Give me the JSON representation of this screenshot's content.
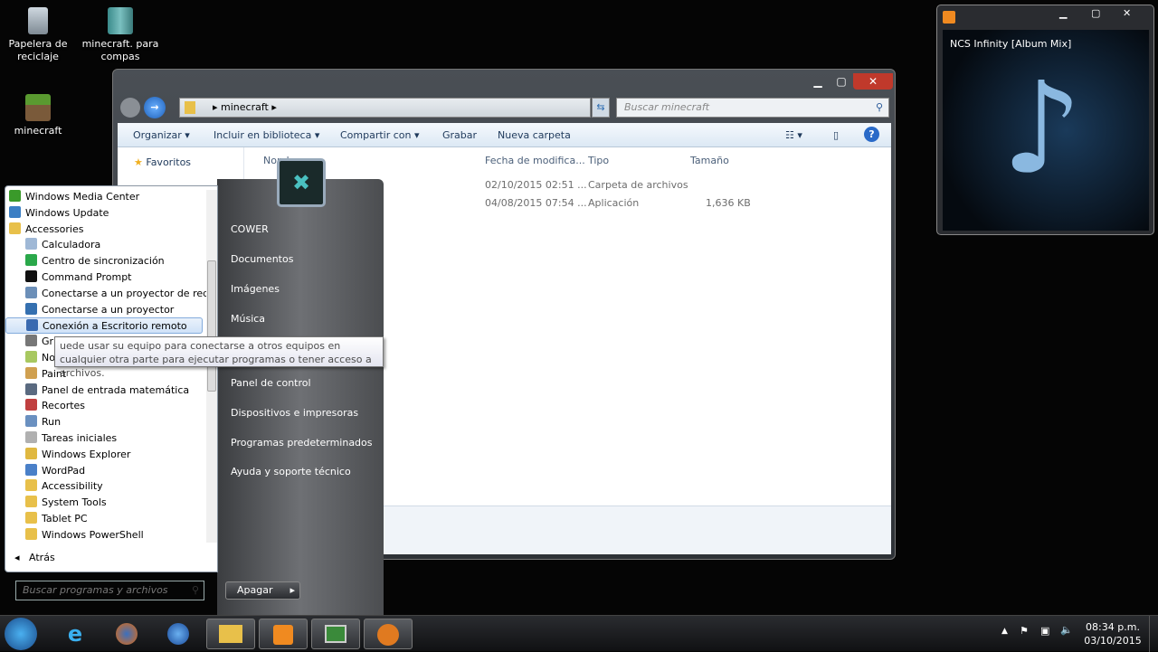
{
  "desktop": {
    "icons": [
      {
        "label": "Papelera de reciclaje",
        "icon": "recycle-bin-icon"
      },
      {
        "label": "minecraft. para compas",
        "icon": "archive-icon"
      },
      {
        "label": "minecraft",
        "icon": "minecraft-icon"
      }
    ]
  },
  "explorer": {
    "path": "minecraft",
    "search_placeholder": "Buscar minecraft",
    "toolbar": {
      "organize": "Organizar ▾",
      "include": "Incluir en biblioteca ▾",
      "share": "Compartir con ▾",
      "burn": "Grabar",
      "new_folder": "Nueva carpeta"
    },
    "nav": {
      "favorites": "Favoritos"
    },
    "columns": {
      "name": "Nombre",
      "date": "Fecha de modifica...",
      "type": "Tipo",
      "size": "Tamaño"
    },
    "rows": [
      {
        "date": "02/10/2015 02:51 ...",
        "type": "Carpeta de archivos",
        "size": ""
      },
      {
        "date": "04/08/2015 07:54 ...",
        "type": "Aplicación",
        "size": "1,636 KB"
      }
    ]
  },
  "start_menu": {
    "programs": [
      {
        "label": "Windows Media Center",
        "color": "#3a9a2a",
        "indent": false
      },
      {
        "label": "Windows Update",
        "color": "#3b7fc4",
        "indent": false
      },
      {
        "label": "Accessories",
        "color": "#e8c04a",
        "indent": false
      },
      {
        "label": "Calculadora",
        "color": "#9fb8d6",
        "indent": true
      },
      {
        "label": "Centro de sincronización",
        "color": "#2aa84a",
        "indent": true
      },
      {
        "label": "Command Prompt",
        "color": "#111111",
        "indent": true
      },
      {
        "label": "Conectarse a un proyector de red",
        "color": "#6c8fb8",
        "indent": true
      },
      {
        "label": "Conectarse a un proyector",
        "color": "#3570b0",
        "indent": true
      },
      {
        "label": "Conexión a Escritorio remoto",
        "color": "#3a6ab0",
        "indent": true,
        "selected": true
      },
      {
        "label": "Gr",
        "color": "#777777",
        "indent": true
      },
      {
        "label": "No",
        "color": "#a8c860",
        "indent": true
      },
      {
        "label": "Paint",
        "color": "#d0a050",
        "indent": true
      },
      {
        "label": "Panel de entrada matemática",
        "color": "#5a6a80",
        "indent": true
      },
      {
        "label": "Recortes",
        "color": "#c04040",
        "indent": true
      },
      {
        "label": "Run",
        "color": "#6a90c0",
        "indent": true
      },
      {
        "label": "Tareas iniciales",
        "color": "#b0b0b0",
        "indent": true
      },
      {
        "label": "Windows Explorer",
        "color": "#e0b840",
        "indent": true
      },
      {
        "label": "WordPad",
        "color": "#4a80c8",
        "indent": true
      },
      {
        "label": "Accessibility",
        "color": "#e8c04a",
        "indent": true
      },
      {
        "label": "System Tools",
        "color": "#e8c04a",
        "indent": true
      },
      {
        "label": "Tablet PC",
        "color": "#e8c04a",
        "indent": true
      },
      {
        "label": "Windows PowerShell",
        "color": "#e8c04a",
        "indent": true
      }
    ],
    "back": "Atrás",
    "search_placeholder": "Buscar programas y archivos",
    "right_items": [
      "COWER",
      "Documentos",
      "Imágenes",
      "Música",
      "Panel de control",
      "Dispositivos e impresoras",
      "Programas predeterminados",
      "Ayuda y soporte técnico"
    ],
    "shutdown": "Apagar",
    "tooltip": "uede usar su equipo para conectarse a otros equipos en cualquier otra parte para ejecutar programas o tener acceso a archivos."
  },
  "media_player": {
    "title": "NCS Infinity [Album Mix]"
  },
  "taskbar": {
    "apps": [
      "start-orb",
      "internet-explorer",
      "firefox",
      "media-player",
      "windows-explorer",
      "media-player-window",
      "remote-desktop",
      "gimp"
    ],
    "time": "08:34 p.m.",
    "date": "03/10/2015"
  }
}
